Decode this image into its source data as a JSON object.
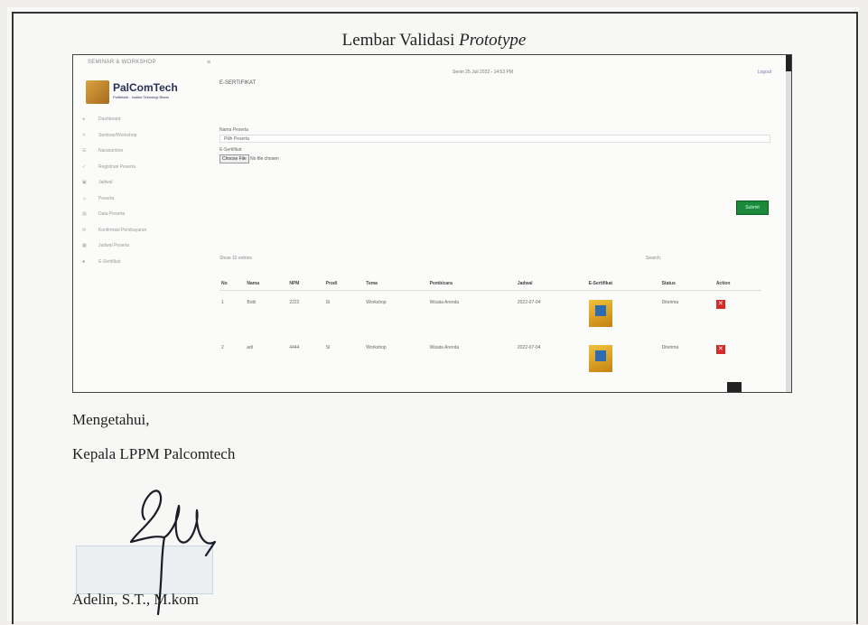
{
  "document": {
    "title_main": "Lembar Validasi ",
    "title_italic": "Prototype",
    "acknowledge": "Mengetahui,",
    "position": "Kepala LPPM Palcomtech",
    "signer": "Adelin, S.T., M.kom"
  },
  "app": {
    "header_brand": "SEMINAR & WORKSHOP",
    "datetime": "Senin 25 Juli 2022 - 14:53 PM",
    "logout": "Logout",
    "logo_text": "PalComTech",
    "logo_sub": "Politeknik - Institut Teknologi Bisnis",
    "page_name": "E-SERTIFIKAT",
    "menu": [
      "Dashboard",
      "Seminar/Workshop",
      "Narasumber",
      "Registrasi Peserta",
      "Jadwal",
      "Peserta",
      "Data Peserta",
      "Konfirmasi Pembayaran",
      "Jadwal Peserta",
      "E-Sertifikat"
    ],
    "form": {
      "name_label": "Nama Peserta",
      "name_value": "Pilih Peserta",
      "cert_label": "E-Sertifikat",
      "choose_file": "Choose File",
      "no_file": "No file chosen",
      "submit": "Submit"
    },
    "table": {
      "show_entries": "Show 10 entries",
      "search_label": "Search:",
      "columns": [
        "No",
        "Nama",
        "NPM",
        "Prodi",
        "Tema",
        "Pembicara",
        "Jadwal",
        "E-Sertifikat",
        "Status",
        "Action"
      ],
      "rows": [
        [
          "1",
          "Bobi",
          "2222",
          "SI",
          "Workshop",
          "Wisata Arenda",
          "2022-07-04",
          "",
          "Diterima",
          ""
        ],
        [
          "2",
          "adi",
          "4444",
          "SI",
          "Workshop",
          "Wisata Arenda",
          "2022-07-04",
          "",
          "Diterima",
          ""
        ]
      ]
    }
  }
}
